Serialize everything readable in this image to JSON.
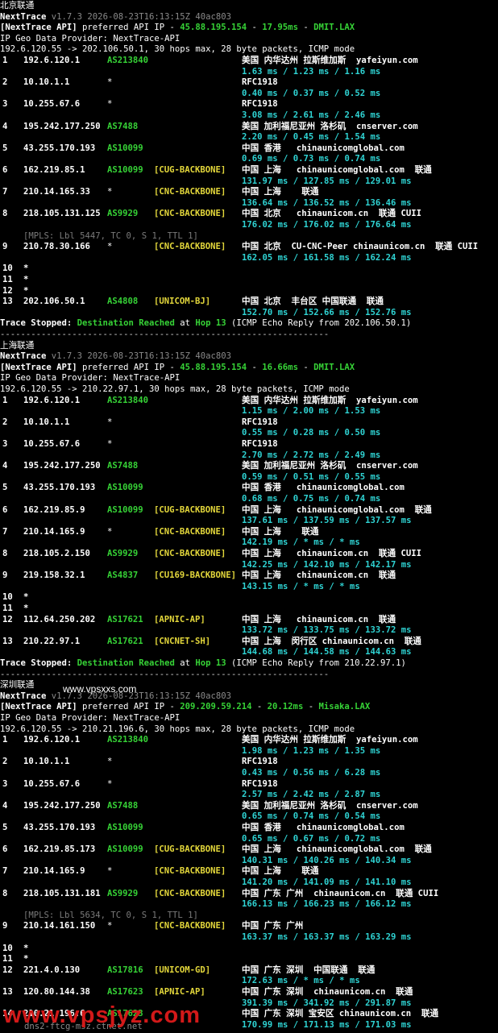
{
  "watermark": "www.vpsxxs.com",
  "footer_watermark": "www.vpsjyz.com",
  "footer_partial": "dns2-ftcg-msz.ctnet.net",
  "sections": [
    {
      "title": "北京联通",
      "app": "NextTrace",
      "version": "v1.7.3 2026-08-23T16:13:15Z 40ac803",
      "api_tag": "[NextTrace API]",
      "api_text": "preferred API IP - ",
      "api_ip": "45.88.195.154",
      "api_sep": " - ",
      "api_ms": "17.95ms",
      "api_sep2": " - ",
      "api_loc": "DMIT.LAX",
      "geo": "IP Geo Data Provider: NextTrace-API",
      "cmd": "192.6.120.55 -> 202.106.50.1, 30 hops max, 28 byte packets, ICMP mode",
      "hops": [
        {
          "n": "1",
          "ip": "192.6.120.1",
          "as": "AS213840",
          "tag": "",
          "geo": "美国 内华达州 拉斯维加斯  yafeiyun.com",
          "rtt": "1.63 ms / 1.23 ms / 1.16 ms"
        },
        {
          "n": "2",
          "ip": "10.10.1.1",
          "as": "*",
          "tag": "",
          "geo": "RFC1918",
          "rtt": "0.40 ms / 0.37 ms / 0.52 ms"
        },
        {
          "n": "3",
          "ip": "10.255.67.6",
          "as": "*",
          "tag": "",
          "geo": "RFC1918",
          "rtt": "3.08 ms / 2.61 ms / 2.46 ms"
        },
        {
          "n": "4",
          "ip": "195.242.177.250",
          "as": "AS7488",
          "tag": "",
          "geo": "美国 加利福尼亚州 洛杉矶  cnserver.com",
          "rtt": "2.20 ms / 0.45 ms / 1.54 ms"
        },
        {
          "n": "5",
          "ip": "43.255.170.193",
          "as": "AS10099",
          "tag": "",
          "geo": "中国 香港   chinaunicomglobal.com",
          "rtt": "0.69 ms / 0.73 ms / 0.74 ms"
        },
        {
          "n": "6",
          "ip": "162.219.85.1",
          "as": "AS10099",
          "tag": "[CUG-BACKBONE]",
          "geo": "中国 上海   chinaunicomglobal.com  联通",
          "rtt": "131.97 ms / 127.85 ms / 129.01 ms"
        },
        {
          "n": "7",
          "ip": "210.14.165.33",
          "as": "*",
          "tag": "[CNC-BACKBONE]",
          "geo": "中国 上海    联通",
          "rtt": "136.64 ms / 136.52 ms / 136.46 ms"
        },
        {
          "n": "8",
          "ip": "218.105.131.125",
          "as": "AS9929",
          "tag": "[CNC-BACKBONE]",
          "geo": "中国 北京   chinaunicom.cn  联通 CUII",
          "rtt": "176.02 ms / 176.02 ms / 176.64 ms"
        },
        {
          "n": "9",
          "ip": "210.78.30.166",
          "as": "*",
          "tag": "[CNC-BACKBONE]",
          "geo": "中国 北京  CU-CNC-Peer chinaunicom.cn  联通 CUII",
          "rtt": "162.05 ms / 161.58 ms / 162.24 ms",
          "mpls": "[MPLS: Lbl 5447, TC 0, S 1, TTL 1]"
        },
        {
          "n": "10",
          "ip": "*",
          "as": "",
          "tag": "",
          "geo": "",
          "rtt": ""
        },
        {
          "n": "11",
          "ip": "*",
          "as": "",
          "tag": "",
          "geo": "",
          "rtt": ""
        },
        {
          "n": "12",
          "ip": "*",
          "as": "",
          "tag": "",
          "geo": "",
          "rtt": ""
        },
        {
          "n": "13",
          "ip": "202.106.50.1",
          "as": "AS4808",
          "tag": "[UNICOM-BJ]",
          "geo": "中国 北京  丰台区 中国联通  联通",
          "rtt": "152.70 ms / 152.66 ms / 152.76 ms"
        }
      ],
      "stop_a": "Trace Stopped: ",
      "stop_b": "Destination Reached",
      "stop_c": " at ",
      "stop_d": "Hop 13",
      "stop_e": " (ICMP Echo Reply from 202.106.50.1)"
    },
    {
      "title": "上海联通",
      "app": "NextTrace",
      "version": "v1.7.3 2026-08-23T16:13:15Z 40ac803",
      "api_tag": "[NextTrace API]",
      "api_text": "preferred API IP - ",
      "api_ip": "45.88.195.154",
      "api_sep": " - ",
      "api_ms": "16.66ms",
      "api_sep2": " - ",
      "api_loc": "DMIT.LAX",
      "geo": "IP Geo Data Provider: NextTrace-API",
      "cmd": "192.6.120.55 -> 210.22.97.1, 30 hops max, 28 byte packets, ICMP mode",
      "hops": [
        {
          "n": "1",
          "ip": "192.6.120.1",
          "as": "AS213840",
          "tag": "",
          "geo": "美国 内华达州 拉斯维加斯  yafeiyun.com",
          "rtt": "1.15 ms / 2.00 ms / 1.53 ms"
        },
        {
          "n": "2",
          "ip": "10.10.1.1",
          "as": "*",
          "tag": "",
          "geo": "RFC1918",
          "rtt": "0.55 ms / 0.28 ms / 0.50 ms"
        },
        {
          "n": "3",
          "ip": "10.255.67.6",
          "as": "*",
          "tag": "",
          "geo": "RFC1918",
          "rtt": "2.70 ms / 2.72 ms / 2.49 ms"
        },
        {
          "n": "4",
          "ip": "195.242.177.250",
          "as": "AS7488",
          "tag": "",
          "geo": "美国 加利福尼亚州 洛杉矶  cnserver.com",
          "rtt": "0.59 ms / 0.51 ms / 0.55 ms"
        },
        {
          "n": "5",
          "ip": "43.255.170.193",
          "as": "AS10099",
          "tag": "",
          "geo": "中国 香港   chinaunicomglobal.com",
          "rtt": "0.68 ms / 0.75 ms / 0.74 ms"
        },
        {
          "n": "6",
          "ip": "162.219.85.9",
          "as": "AS10099",
          "tag": "[CUG-BACKBONE]",
          "geo": "中国 上海   chinaunicomglobal.com  联通",
          "rtt": "137.61 ms / 137.59 ms / 137.57 ms"
        },
        {
          "n": "7",
          "ip": "210.14.165.9",
          "as": "*",
          "tag": "[CNC-BACKBONE]",
          "geo": "中国 上海    联通",
          "rtt": "142.19 ms / * ms / * ms"
        },
        {
          "n": "8",
          "ip": "218.105.2.150",
          "as": "AS9929",
          "tag": "[CNC-BACKBONE]",
          "geo": "中国 上海   chinaunicom.cn  联通 CUII",
          "rtt": "142.25 ms / 142.10 ms / 142.17 ms"
        },
        {
          "n": "9",
          "ip": "219.158.32.1",
          "as": "AS4837",
          "tag": "[CU169-BACKBONE]",
          "geo": "中国 上海   chinaunicom.cn  联通",
          "rtt": "143.15 ms / * ms / * ms"
        },
        {
          "n": "10",
          "ip": "*",
          "as": "",
          "tag": "",
          "geo": "",
          "rtt": ""
        },
        {
          "n": "11",
          "ip": "*",
          "as": "",
          "tag": "",
          "geo": "",
          "rtt": ""
        },
        {
          "n": "12",
          "ip": "112.64.250.202",
          "as": "AS17621",
          "tag": "[APNIC-AP]",
          "geo": "中国 上海   chinaunicom.cn  联通",
          "rtt": "133.72 ms / 133.75 ms / 133.72 ms"
        },
        {
          "n": "13",
          "ip": "210.22.97.1",
          "as": "AS17621",
          "tag": "[CNCNET-SH]",
          "geo": "中国 上海  闵行区 chinaunicom.cn  联通",
          "rtt": "144.68 ms / 144.58 ms / 144.63 ms"
        }
      ],
      "stop_a": "Trace Stopped: ",
      "stop_b": "Destination Reached",
      "stop_c": " at ",
      "stop_d": "Hop 13",
      "stop_e": " (ICMP Echo Reply from 210.22.97.1)"
    },
    {
      "title": "深圳联通",
      "app": "NextTrace",
      "version": "v1.7.3 2026-08-23T16:13:15Z 40ac803",
      "api_tag": "[NextTrace API]",
      "api_text": "preferred API IP - ",
      "api_ip": "209.209.59.214",
      "api_sep": " - ",
      "api_ms": "20.12ms",
      "api_sep2": " - ",
      "api_loc": "Misaka.LAX",
      "geo": "IP Geo Data Provider: NextTrace-API",
      "cmd": "192.6.120.55 -> 210.21.196.6, 30 hops max, 28 byte packets, ICMP mode",
      "hops": [
        {
          "n": "1",
          "ip": "192.6.120.1",
          "as": "AS213840",
          "tag": "",
          "geo": "美国 内华达州 拉斯维加斯  yafeiyun.com",
          "rtt": "1.98 ms / 1.23 ms / 1.35 ms"
        },
        {
          "n": "2",
          "ip": "10.10.1.1",
          "as": "*",
          "tag": "",
          "geo": "RFC1918",
          "rtt": "0.43 ms / 0.56 ms / 6.28 ms"
        },
        {
          "n": "3",
          "ip": "10.255.67.6",
          "as": "*",
          "tag": "",
          "geo": "RFC1918",
          "rtt": "2.57 ms / 2.42 ms / 2.87 ms"
        },
        {
          "n": "4",
          "ip": "195.242.177.250",
          "as": "AS7488",
          "tag": "",
          "geo": "美国 加利福尼亚州 洛杉矶  cnserver.com",
          "rtt": "0.65 ms / 0.74 ms / 0.54 ms"
        },
        {
          "n": "5",
          "ip": "43.255.170.193",
          "as": "AS10099",
          "tag": "",
          "geo": "中国 香港   chinaunicomglobal.com",
          "rtt": "0.65 ms / 0.67 ms / 0.72 ms"
        },
        {
          "n": "6",
          "ip": "162.219.85.173",
          "as": "AS10099",
          "tag": "[CUG-BACKBONE]",
          "geo": "中国 上海   chinaunicomglobal.com  联通",
          "rtt": "140.31 ms / 140.26 ms / 140.34 ms"
        },
        {
          "n": "7",
          "ip": "210.14.165.9",
          "as": "*",
          "tag": "[CNC-BACKBONE]",
          "geo": "中国 上海    联通",
          "rtt": "141.20 ms / 141.09 ms / 141.10 ms"
        },
        {
          "n": "8",
          "ip": "218.105.131.181",
          "as": "AS9929",
          "tag": "[CNC-BACKBONE]",
          "geo": "中国 广东 广州  chinaunicom.cn  联通 CUII",
          "rtt": "166.13 ms / 166.23 ms / 166.12 ms"
        },
        {
          "n": "9",
          "ip": "210.14.161.150",
          "as": "*",
          "tag": "[CNC-BACKBONE]",
          "geo": "中国 广东 广州",
          "rtt": "163.37 ms / 163.37 ms / 163.29 ms",
          "mpls": "[MPLS: Lbl 5634, TC 0, S 1, TTL 1]"
        },
        {
          "n": "10",
          "ip": "*",
          "as": "",
          "tag": "",
          "geo": "",
          "rtt": ""
        },
        {
          "n": "11",
          "ip": "*",
          "as": "",
          "tag": "",
          "geo": "",
          "rtt": ""
        },
        {
          "n": "12",
          "ip": "221.4.0.130",
          "as": "AS17816",
          "tag": "[UNICOM-GD]",
          "geo": "中国 广东 深圳  中国联通  联通",
          "rtt": "172.63 ms / * ms / * ms"
        },
        {
          "n": "13",
          "ip": "120.80.144.38",
          "as": "AS17623",
          "tag": "[APNIC-AP]",
          "geo": "中国 广东 深圳  chinaunicom.cn  联通",
          "rtt": "391.39 ms / 341.92 ms / 291.87 ms"
        },
        {
          "n": "14",
          "ip": "210.21.196.6",
          "as": "AS17623",
          "tag": "",
          "geo": "中国 广东 深圳 宝安区 chinaunicom.cn  联通",
          "rtt": "170.99 ms / 171.13 ms / 171.03 ms"
        }
      ]
    }
  ]
}
